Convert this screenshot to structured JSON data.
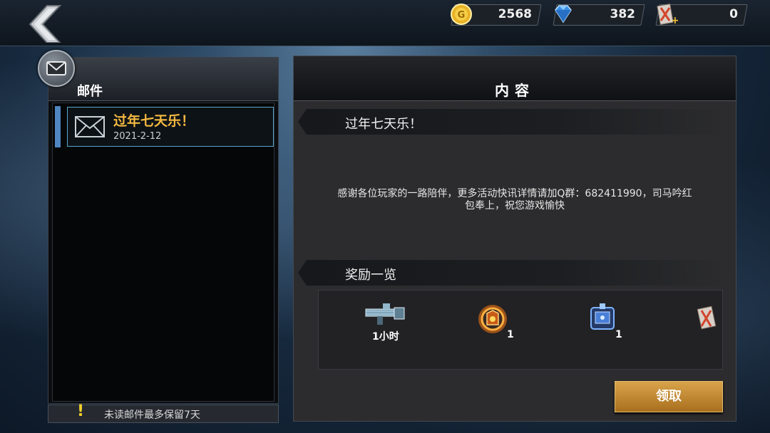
{
  "currencies": {
    "gold": {
      "icon": "gold-coin-icon",
      "value": "2568"
    },
    "diamond": {
      "icon": "diamond-icon",
      "value": "382"
    },
    "ticket": {
      "icon": "ticket-card-icon",
      "value": "0"
    }
  },
  "mail_panel": {
    "title": "邮件",
    "items": [
      {
        "subject": "过年七天乐！",
        "date": "2021-2-12",
        "selected": true
      }
    ],
    "notice": "未读邮件最多保留7天"
  },
  "content_panel": {
    "title": "内容",
    "mail_subject": "过年七天乐！",
    "message_line1": "感谢各位玩家的一路陪伴，更多活动快讯详情请加Q群：682411990，司马吟红",
    "message_line2": "包奉上，祝您游戏愉快",
    "rewards_heading": "奖励一览",
    "rewards": [
      {
        "icon": "minigun-weapon-icon",
        "qty": "1小时"
      },
      {
        "icon": "fire-crest-item-icon",
        "qty": "1"
      },
      {
        "icon": "blue-armor-item-icon",
        "qty": "1"
      },
      {
        "icon": "ticket-card-icon",
        "qty": ""
      }
    ],
    "claim_label": "领取"
  },
  "colors": {
    "accent_gold": "#f3b840",
    "claim_button": "#c58a34",
    "selection_border": "#58a6cf"
  }
}
